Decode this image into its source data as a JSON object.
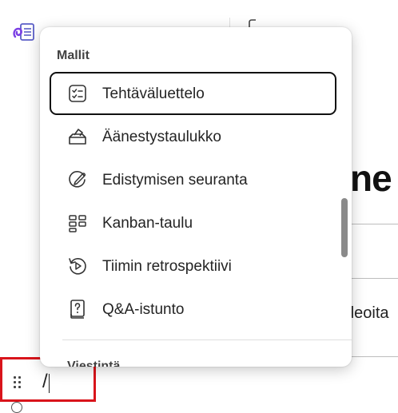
{
  "background": {
    "heading_fragment": "ne",
    "text_fragment": "deoita"
  },
  "menu": {
    "section_title": "Mallit",
    "items": [
      {
        "label": "Tehtäväluettelo",
        "icon": "task-list-icon",
        "selected": true
      },
      {
        "label": "Äänestystaulukko",
        "icon": "ballot-box-icon",
        "selected": false
      },
      {
        "label": "Edistymisen seuranta",
        "icon": "progress-tracker-icon",
        "selected": false
      },
      {
        "label": "Kanban-taulu",
        "icon": "kanban-board-icon",
        "selected": false
      },
      {
        "label": "Tiimin retrospektiivi",
        "icon": "retrospective-icon",
        "selected": false
      },
      {
        "label": "Q&A-istunto",
        "icon": "qa-session-icon",
        "selected": false
      }
    ],
    "next_section_title": "Viestintä"
  },
  "editor": {
    "typed_text": "/"
  },
  "colors": {
    "highlight_border": "#d9141b",
    "scrollbar_thumb": "#8a8a8a",
    "app_icon_accent": "#5b5fc7"
  }
}
